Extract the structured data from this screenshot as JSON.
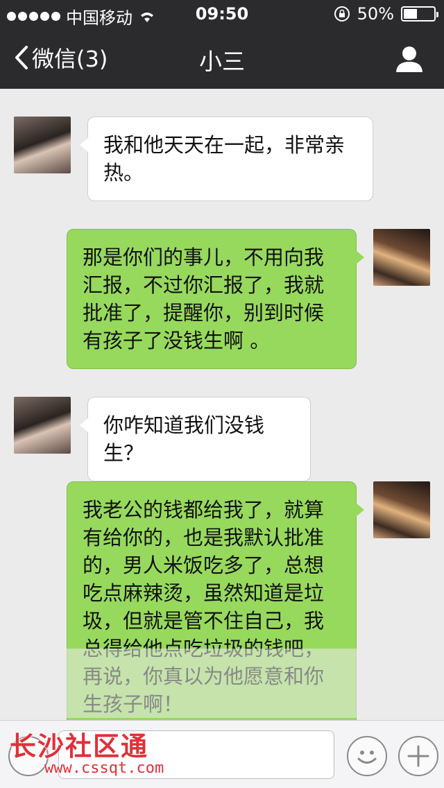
{
  "status_bar": {
    "carrier": "中国移动",
    "time": "09:50",
    "battery_percent_text": "50%",
    "battery_level": 0.5
  },
  "nav": {
    "back_label": "微信(3)",
    "title": "小三"
  },
  "messages": [
    {
      "side": "left",
      "text": "我和他天天在一起，非常亲热。"
    },
    {
      "side": "right",
      "text": "那是你们的事儿，不用向我汇报，不过你汇报了，我就批准了，提醒你，别到时候有孩子了没钱生啊 。"
    },
    {
      "side": "left",
      "text": "你咋知道我们没钱生？"
    },
    {
      "side": "right",
      "text": "我老公的钱都给我了，就算有给你的，也是我默认批准的，男人米饭吃多了，总想吃点麻辣烫，虽然知道是垃圾，但就是管不住自己，我总得给他点吃垃圾的钱吧，再说，你真以为他愿意和你生孩子啊！"
    }
  ],
  "watermark": {
    "title": "长沙社区通",
    "url": "www.cssqt.com"
  },
  "colors": {
    "nav_background": "#2b2b2d",
    "chat_background": "#ebebeb",
    "outgoing_bubble": "#97d95d",
    "incoming_bubble": "#ffffff",
    "watermark": "#e0303a"
  }
}
